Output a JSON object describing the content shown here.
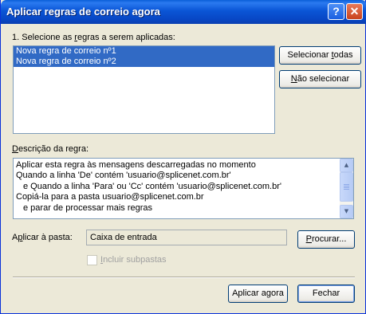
{
  "window": {
    "title": "Aplicar regras de correio agora",
    "help_glyph": "?",
    "close_glyph": "✕"
  },
  "rules_section": {
    "label": "1. Selecione as regras a serem aplicadas:",
    "rules": [
      {
        "label": "Nova regra de correio nº1",
        "selected": true
      },
      {
        "label": "Nova regra de correio nº2",
        "selected": true
      }
    ],
    "select_all_label": "Selecionar todas",
    "select_none_label": "Não selecionar"
  },
  "description_section": {
    "label": "Descrição da regra:",
    "lines": [
      "Aplicar esta regra às mensagens descarregadas no momento",
      "Quando a linha 'De' contém 'usuario@splicenet.com.br'",
      "e Quando a linha 'Para' ou 'Cc' contém 'usuario@splicenet.com.br'",
      "Copiá-la para a pasta usuario@splicenet.com.br",
      "e parar de processar mais regras"
    ]
  },
  "folder_section": {
    "label": "Aplicar à pasta:",
    "value": "Caixa de entrada",
    "browse_label": "Procurar...",
    "include_subfolders_label": "Incluir subpastas",
    "include_subfolders_checked": false
  },
  "footer": {
    "apply_label": "Aplicar agora",
    "close_label": "Fechar"
  },
  "colors": {
    "title_bar": "#0a55d6",
    "selection": "#316ac5",
    "dialog_bg": "#ece9d8"
  }
}
